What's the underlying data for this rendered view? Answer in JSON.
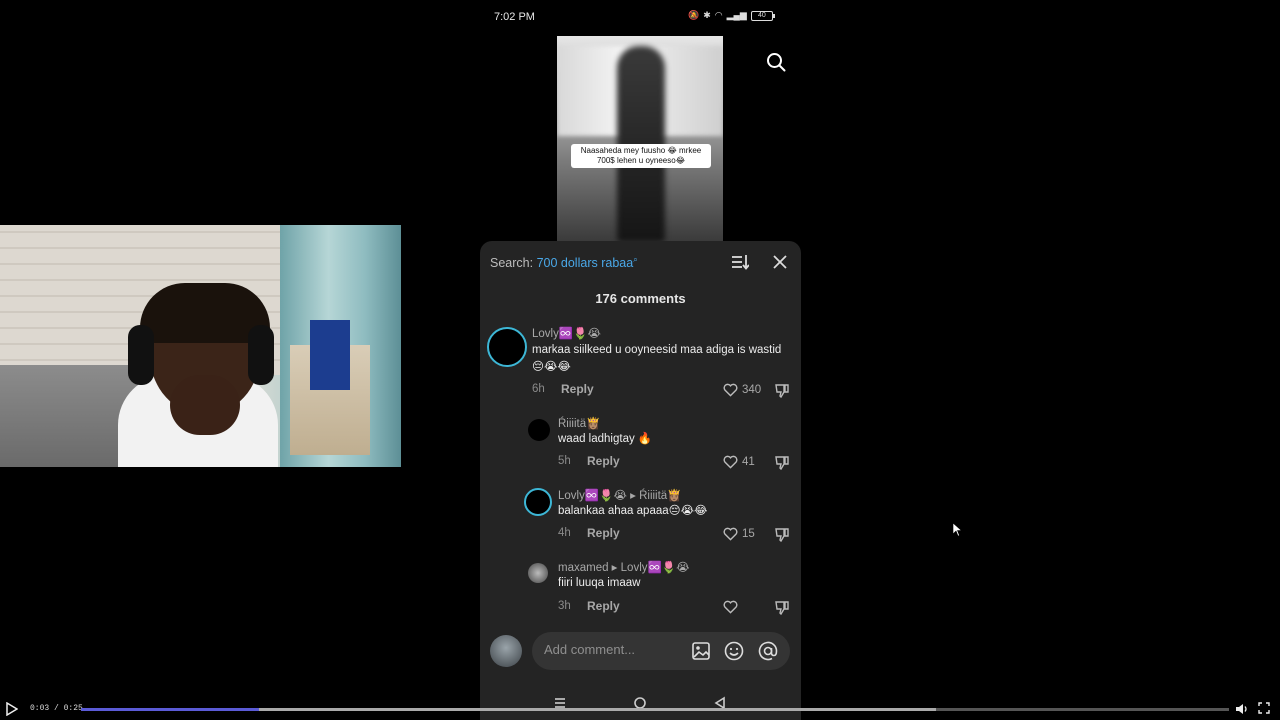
{
  "status_bar": {
    "time": "7:02 PM",
    "battery": "40"
  },
  "video": {
    "caption": "Naasaheda mey fuusho 😂 mrkee 700$ lehen u oyneeso😂"
  },
  "panel": {
    "search_label": "Search:",
    "search_term": "700 dollars rabaa",
    "comment_count": "176 comments",
    "comments": [
      {
        "user": "Lovly♾️🌷😭",
        "text": "markaa siilkeed u ooyneesid maa adiga is wastid 😔😭😂",
        "time": "6h",
        "reply": "Reply",
        "likes": "340"
      },
      {
        "user": "Ŕiiiitä👸🏽",
        "text": "waad ladhigtay 🔥",
        "time": "5h",
        "reply": "Reply",
        "likes": "41"
      },
      {
        "user": "Lovly♾️🌷😭 ▸ Ŕiiiitä👸🏽",
        "text": "balankaa ahaa apaaa😔😭😂",
        "time": "4h",
        "reply": "Reply",
        "likes": "15"
      },
      {
        "user": "maxamed ▸ Lovly♾️🌷😭",
        "text": "fiiri luuqa imaaw",
        "time": "3h",
        "reply": "Reply",
        "likes": ""
      }
    ],
    "input_placeholder": "Add comment..."
  },
  "player": {
    "time": "0:03 / 0:25",
    "progress": 0.155,
    "buffered": 0.745
  },
  "colors": {
    "accent": "#4aa8e8",
    "ring": "#3db7d6",
    "progress": "#5b5bd6",
    "panel": "#242424"
  }
}
